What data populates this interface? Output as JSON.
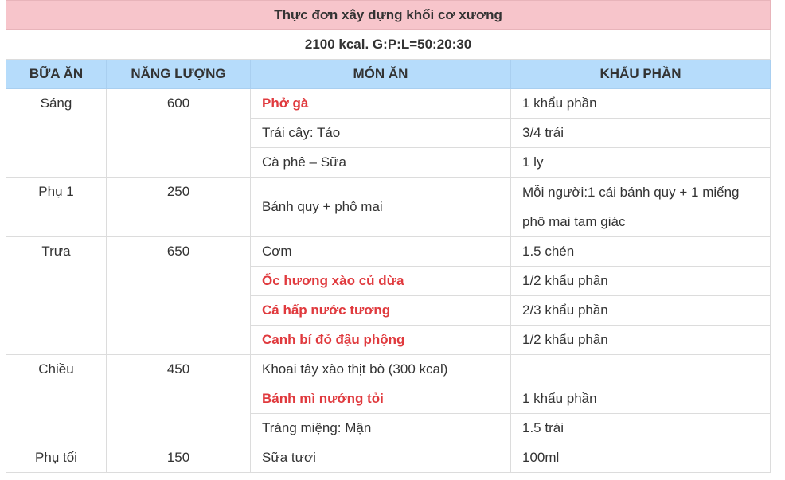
{
  "title": "Thực đơn xây dựng khối cơ xương",
  "subtitle": "2100 kcal. G:P:L=50:20:30",
  "headers": [
    "BỮA ĂN",
    "NĂNG LƯỢNG",
    "MÓN ĂN",
    "KHẨU PHẦN"
  ],
  "accent_color": "#e03a3e",
  "title_bg": "#f7c5cb",
  "header_bg": "#b6dcfb",
  "meals": [
    {
      "name": "Sáng",
      "energy": "600",
      "items": [
        {
          "dish": "Phở gà",
          "portion": "1 khẩu phần",
          "highlight": true
        },
        {
          "dish": "Trái cây: Táo",
          "portion": "3/4 trái",
          "highlight": false
        },
        {
          "dish": "Cà phê – Sữa",
          "portion": "1 ly",
          "highlight": false
        }
      ]
    },
    {
      "name": "Phụ 1",
      "energy": "250",
      "items": [
        {
          "dish": "Bánh quy + phô mai",
          "portion": "Mỗi người:1 cái bánh quy + 1 miếng phô mai tam giác",
          "highlight": false
        }
      ]
    },
    {
      "name": "Trưa",
      "energy": "650",
      "items": [
        {
          "dish": "Cơm",
          "portion": "1.5 chén",
          "highlight": false
        },
        {
          "dish": "Ốc hương xào củ dừa",
          "portion": "1/2 khẩu phần",
          "highlight": true
        },
        {
          "dish": "Cá hấp nước tương",
          "portion": "2/3 khẩu phần",
          "highlight": true
        },
        {
          "dish": "Canh bí đỏ đậu phộng",
          "portion": "1/2 khẩu phần",
          "highlight": true
        }
      ]
    },
    {
      "name": "Chiều",
      "energy": "450",
      "items": [
        {
          "dish": "Khoai tây xào thịt bò (300 kcal)",
          "portion": "",
          "highlight": false
        },
        {
          "dish": "Bánh mì nướng tỏi",
          "portion": "1 khẩu phần",
          "highlight": true
        },
        {
          "dish": "Tráng miệng: Mận",
          "portion": "1.5 trái",
          "highlight": false
        }
      ]
    },
    {
      "name": "Phụ tối",
      "energy": "150",
      "items": [
        {
          "dish": "Sữa tươi",
          "portion": "100ml",
          "highlight": false
        }
      ]
    }
  ]
}
